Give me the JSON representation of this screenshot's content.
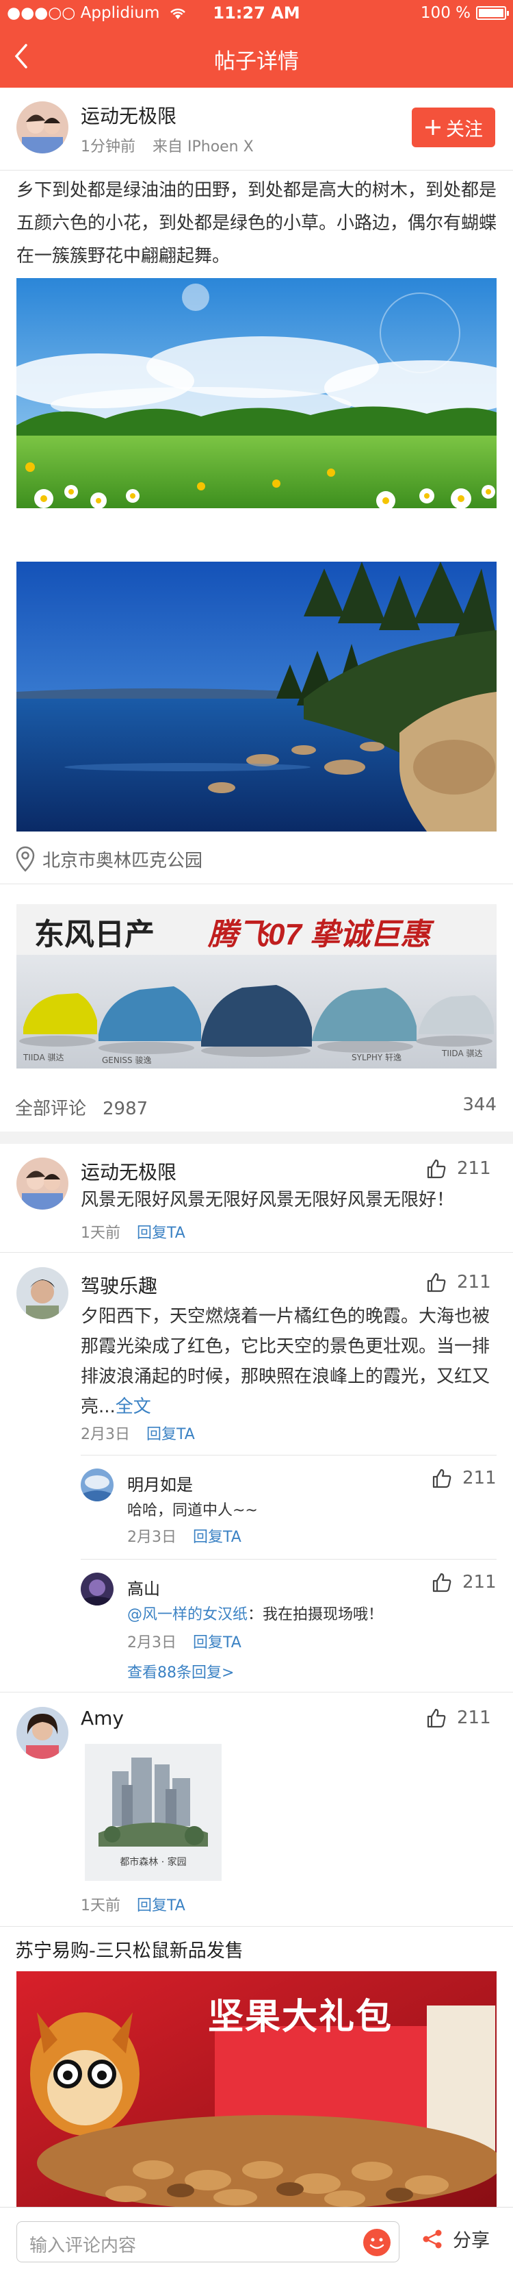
{
  "status_bar": {
    "carrier": "Applidium",
    "time": "11:27 AM",
    "battery": "100 %"
  },
  "nav": {
    "title": "帖子详情"
  },
  "post": {
    "author": "运动无极限",
    "time": "1分钟前",
    "source": "来自 IPhoen X",
    "follow_label": "关注",
    "text": "乡下到处都是绿油油的田野，到处都是高大的树木，到处都是五颜六色的小花，到处都是绿色的小草。小路边，偶尔有蝴蝶在一簇簇野花中翩翩起舞。",
    "location": "北京市奥林匹克公园"
  },
  "ad": {
    "left_text": "东风日产",
    "right_text": "腾飞07 挚诚巨惠",
    "car_labels": [
      "TIIDA 骐达",
      "GENISS 骏逸",
      "SYLPHY 轩逸",
      "TIIDA 骐达"
    ]
  },
  "comments_header": {
    "label": "全部评论",
    "count": "2987",
    "right_count": "344"
  },
  "comments": [
    {
      "name": "运动无极限",
      "likes": "211",
      "text": "风景无限好风景无限好风景无限好风景无限好！",
      "time": "1天前",
      "reply": "回复TA"
    },
    {
      "name": "驾驶乐趣",
      "likes": "211",
      "text": "夕阳西下，天空燃烧着一片橘红色的晚霞。大海也被那霞光染成了红色，它比天空的景色更壮观。当一排排波浪涌起的时候，那映照在浪峰上的霞光，又红又亮...",
      "more": "全文",
      "time": "2月3日",
      "reply": "回复TA"
    },
    {
      "name": "明月如是",
      "likes": "211",
      "text": "哈哈，同道中人~~",
      "time": "2月3日",
      "reply": "回复TA"
    },
    {
      "name": "高山",
      "likes": "211",
      "mention": "@风一样的女汉纸",
      "text": "：我在拍摄现场哦！",
      "time": "2月3日",
      "reply": "回复TA",
      "view_more": "查看88条回复>"
    },
    {
      "name": "Amy",
      "likes": "211",
      "time": "1天前",
      "reply": "回复TA",
      "image_caption": "都市森林 · 家园"
    }
  ],
  "promo": {
    "title": "苏宁易购-三只松鼠新品发售",
    "banner_text": "坚果大礼包"
  },
  "bottom": {
    "placeholder": "输入评论内容",
    "share_label": "分享"
  },
  "colors": {
    "accent": "#f4523b",
    "link": "#3b82c4"
  }
}
